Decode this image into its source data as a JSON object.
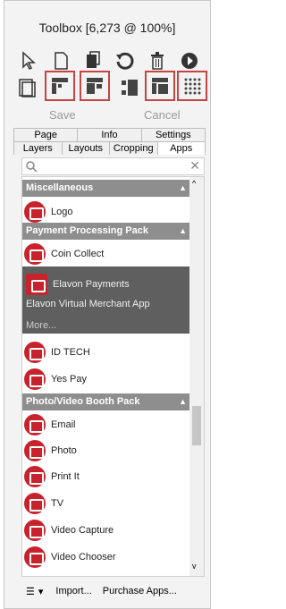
{
  "title": "Toolbox [6,273 @ 100%]",
  "actions": {
    "save": "Save",
    "cancel": "Cancel"
  },
  "tabs_top": [
    "Page",
    "Info",
    "Settings"
  ],
  "tabs_bottom": [
    "Layers",
    "Layouts",
    "Cropping",
    "Apps"
  ],
  "active_tab": "Apps",
  "search": {
    "placeholder": ""
  },
  "sections": {
    "misc": "Miscellaneous",
    "payment": "Payment Processing Pack",
    "photo": "Photo/Video Booth Pack"
  },
  "items": {
    "logo": "Logo",
    "coin": "Coin Collect",
    "elavon_payments": "Elavon Payments",
    "elavon_virtual": "Elavon Virtual Merchant App",
    "more": "More...",
    "idtech": "ID TECH",
    "yespay": "Yes Pay",
    "email": "Email",
    "photo": "Photo",
    "printit": "Print It",
    "tv": "TV",
    "video_capture": "Video Capture",
    "video_chooser": "Video Chooser"
  },
  "footer": {
    "import": "Import...",
    "purchase": "Purchase Apps..."
  },
  "colors": {
    "accent": "#c8232c",
    "dark": "#5f5f5f",
    "section": "#8e8e8e"
  },
  "icons": [
    "pointer-icon",
    "new-page-icon",
    "copy-page-icon",
    "undo-icon",
    "delete-icon",
    "play-icon",
    "page-icon",
    "layout-icon",
    "layout-alt-icon",
    "grid-icon",
    "layout-right-icon",
    "dots-grid-icon"
  ]
}
